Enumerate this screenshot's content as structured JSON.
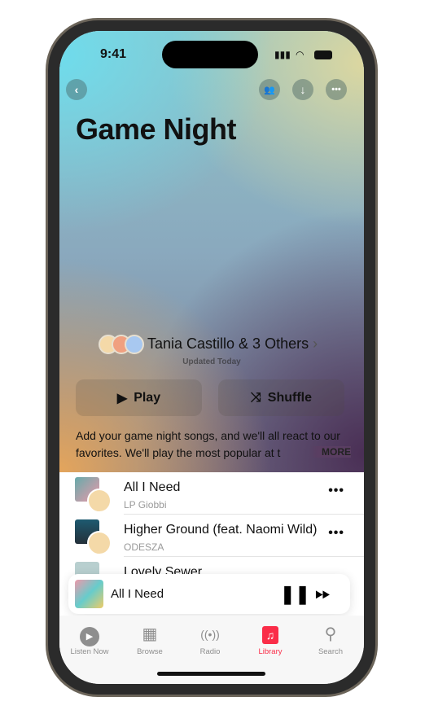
{
  "status": {
    "time": "9:41"
  },
  "playlist": {
    "title": "Game Night",
    "owners": "Tania Castillo & 3 Others",
    "updated": "Updated Today",
    "play_label": "Play",
    "shuffle_label": "Shuffle",
    "description": "Add your game night songs, and we'll all react to our favorites. We'll play the most popular at t",
    "more_label": "MORE"
  },
  "songs": [
    {
      "title": "All I Need",
      "artist": "LP Giobbi"
    },
    {
      "title": "Higher Ground (feat. Naomi Wild)",
      "artist": "ODESZA"
    },
    {
      "title": "Lovely Sewer",
      "artist": ""
    }
  ],
  "now_playing": {
    "title": "All I Need"
  },
  "tabs": [
    {
      "label": "Listen Now",
      "icon": "play-circle-icon"
    },
    {
      "label": "Browse",
      "icon": "grid-icon"
    },
    {
      "label": "Radio",
      "icon": "radio-waves-icon"
    },
    {
      "label": "Library",
      "icon": "music-note-icon",
      "active": true
    },
    {
      "label": "Search",
      "icon": "search-icon"
    }
  ],
  "colors": {
    "accent": "#fa2d48"
  }
}
